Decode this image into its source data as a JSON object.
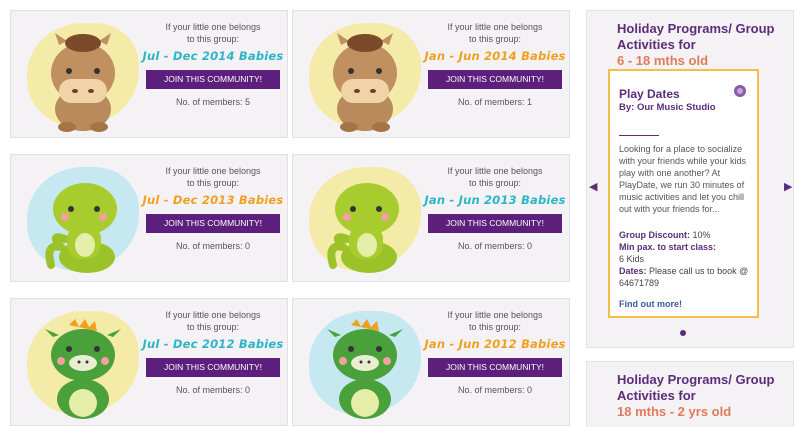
{
  "cards": [
    {
      "intro": "If your little one belongs\nto this group:",
      "group": "Jul - Dec 2014 Babies",
      "group_color": "#2bb6c7",
      "join": "JOIN THIS COMMUNITY!",
      "members": "No. of members: 5",
      "splash": "#f5e66b",
      "animal": "pony"
    },
    {
      "intro": "If your little one belongs\nto this group:",
      "group": "Jan - Jun 2014 Babies",
      "group_color": "#f0a020",
      "join": "JOIN THIS COMMUNITY!",
      "members": "No. of members: 1",
      "splash": "#f5e66b",
      "animal": "pony"
    },
    {
      "intro": "If your little one belongs\nto this group:",
      "group": "Jul - Dec 2013 Babies",
      "group_color": "#f0a020",
      "join": "JOIN THIS COMMUNITY!",
      "members": "No. of members: 0",
      "splash": "#9ee0ef",
      "animal": "snake"
    },
    {
      "intro": "If your little one belongs\nto this group:",
      "group": "Jan - Jun 2013 Babies",
      "group_color": "#2bb6c7",
      "join": "JOIN THIS COMMUNITY!",
      "members": "No. of members: 0",
      "splash": "#f5e66b",
      "animal": "snake"
    },
    {
      "intro": "If your little one belongs\nto this group:",
      "group": "Jul - Dec 2012 Babies",
      "group_color": "#2bb6c7",
      "join": "JOIN THIS COMMUNITY!",
      "members": "No. of members: 0",
      "splash": "#f5e66b",
      "animal": "dragon"
    },
    {
      "intro": "If your little one belongs\nto this group:",
      "group": "Jan - Jun 2012 Babies",
      "group_color": "#f0a020",
      "join": "JOIN THIS COMMUNITY!",
      "members": "No. of members: 0",
      "splash": "#9ee0ef",
      "animal": "dragon"
    }
  ],
  "sidebar": {
    "title": "Holiday Programs/ Group Activities for",
    "age": "6 - 18 mths old",
    "promo": {
      "title": "Play Dates",
      "by": "By: Our Music Studio",
      "description": "Looking for a place to socialize with your friends while your kids play with one another? At PlayDate, we run 30 minutes of music activities and let you chill out with your friends for...",
      "discount_label": "Group Discount:",
      "discount_value": "10%",
      "min_label": "Min pax. to start class:",
      "min_value": "6 Kids",
      "dates_label": "Dates:",
      "dates_value": "Please call us to book @ 64671789",
      "more": "Find out more!"
    },
    "prev_icon": "triangle-left-icon",
    "next_icon": "triangle-right-icon"
  },
  "sidebar2": {
    "title": "Holiday Programs/ Group Activities for",
    "age": "18 mths - 2 yrs old"
  },
  "colors": {
    "accent": "#5c1f7c",
    "promo_border": "#f2c04a",
    "age": "#e07b5a"
  }
}
